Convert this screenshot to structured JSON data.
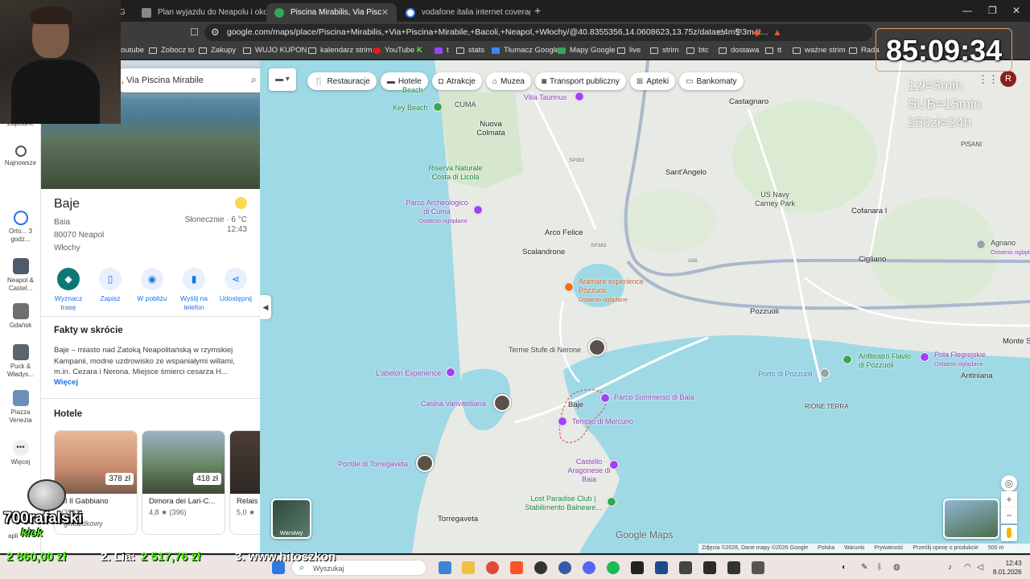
{
  "browser": {
    "tabs": [
      {
        "title": "Plan wyjazdu do Neapolu i okolic - G"
      },
      {
        "title": "Piscina Mirabilis, Via Piscina Mira"
      },
      {
        "title": "vodafone italia internet coverage - S"
      }
    ],
    "tab_prefix": "G",
    "url": "google.com/maps/place/Piscina+Mirabilis,+Via+Piscina+Mirabile,+Bacoli,+Neapol,+Włochy/@40.8355356,14.0608623,13.75z/data=!4m5!3m4!...",
    "bookmarks": [
      "outube",
      "Zobocz to",
      "Zakupy",
      "WUJO KUPON",
      "kalendarz strim",
      "YouTube",
      "K",
      "t",
      "stats",
      "Tłumacz Google",
      "Mapy Google",
      "live",
      "strim",
      "btc",
      "dostawa",
      "tt",
      "ważne strim",
      "Rada"
    ]
  },
  "overlay": {
    "timer": "85:09:34",
    "rules": [
      "1zł=3min",
      "SUB=15min",
      "250zł=24h"
    ],
    "streamer": "700rafalski",
    "platform": "kick",
    "ticker": [
      "2 860,00 zł",
      "2. Lia:",
      "2 517,76 zł",
      "3. www.hitoszkon"
    ]
  },
  "rail": [
    {
      "label": "Zapisane"
    },
    {
      "label": "Najnowsze"
    },
    {
      "label": "Orto... 3 godz..."
    },
    {
      "label": "Neapol & Castel..."
    },
    {
      "label": "Gdańsk"
    },
    {
      "label": "Puck & Władys..."
    },
    {
      "label": "Piazza Venezia"
    },
    {
      "label": "Więcej"
    },
    {
      "label": "apli"
    }
  ],
  "search": {
    "value": ", Via Piscina Mirabile"
  },
  "place": {
    "name": "Baje",
    "line1": "Baia",
    "line2": "80070 Neapol",
    "line3": "Włochy",
    "weather": "Słonecznie · 6 °C",
    "time": "12:43"
  },
  "actions": [
    {
      "label": "Wyznacz trasę"
    },
    {
      "label": "Zapisz"
    },
    {
      "label": "W pobliżu"
    },
    {
      "label": "Wyślij na telefon"
    },
    {
      "label": "Udostępnij"
    }
  ],
  "facts": {
    "heading": "Fakty w skrócie",
    "text": "Baje – miasto nad Zatoką Neapolitańską w rzymskiej Kampanii, modne uzdrowisko ze wspaniałymi willami, m.in. Cezara i Nerona. Miejsce śmierci cesarza H...",
    "more": "Więcej"
  },
  "hotels": {
    "heading": "Hotele",
    "items": [
      {
        "name": "el Il Gabbiano",
        "price": "378 zł",
        "rating": "(3531)",
        "sub": "-gwiazdkowy"
      },
      {
        "name": "Dimora dei Lari-C...",
        "price": "418 zł",
        "rating": "4,8 ★ (396)",
        "sub": ""
      },
      {
        "name": "Relais",
        "price": "",
        "rating": "5,0 ★",
        "sub": ""
      }
    ]
  },
  "chips": [
    {
      "label": "Restauracje",
      "icon": "fork-knife-icon"
    },
    {
      "label": "Hotele",
      "icon": "bed-icon"
    },
    {
      "label": "Atrakcje",
      "icon": "camera-icon"
    },
    {
      "label": "Muzea",
      "icon": "museum-icon"
    },
    {
      "label": "Transport publiczny",
      "icon": "train-icon"
    },
    {
      "label": "Apteki",
      "icon": "pharmacy-icon"
    },
    {
      "label": "Bankomaty",
      "icon": "atm-icon"
    }
  ],
  "map": {
    "labels": {
      "villa": "Villa Taurinus",
      "castagnaro": "Castagnaro",
      "keybeach": "Key Beach",
      "cuma": "CUMA",
      "beach": "Beach",
      "nuova": "Nuova Colmata",
      "riserva": "Riserva Naturale Costa di Licola",
      "santangelo": "Sant'Angelo",
      "usnavy": "US Navy Carney Park",
      "pisani": "PISANI",
      "cofanara": "Cofanara I",
      "parco": "Parco Archeologico di Cuma",
      "parco_sub": "Ostatnio oglądane",
      "arco": "Arco Felice",
      "scalandrone": "Scalandrone",
      "agnano": "Agnano",
      "agnano_sub": "Ostatnio oglądane",
      "cigliano": "Cigliano",
      "aramare": "Aramare experience Pozzuoli",
      "aramare_sub": "Ostatnio oglądane",
      "pozzuoli": "Pozzuoli",
      "terme": "Terme Stufe di Nerone",
      "anfiteatro": "Anfiteatro Flavio di Pozzuoli",
      "pola": "Pola Flegrejskie",
      "pola_sub": "Ostatnio oglądane",
      "monte": "Monte S",
      "labelon": "L'abelon Experience",
      "porto": "Porto di Pozzuoli",
      "antiniana": "Antiniana",
      "sommerso": "Parco Sommerso di Baia",
      "casina": "Casina Vanvitelliana",
      "baje": "Baje",
      "rione": "RIONE TERRA",
      "tempio": "Tempio di Mercurio",
      "castello": "Castello Aragonese di Baia",
      "pontile": "Pontile di Torregaveta",
      "lost": "Lost Paradise Club | Stabilimento Balneare...",
      "torregaveta": "Torregaveta",
      "sp": "SP383",
      "a56": "A56"
    },
    "layers_label": "Warstwy",
    "logo": "Google Maps",
    "footer": [
      "Zdjęcia ©2026, Dane mapy ©2026 Google",
      "Polska",
      "Warunki",
      "Prywatność",
      "Prześlij opinię o produkcie",
      "500 m"
    ]
  },
  "taskbar": {
    "search_placeholder": "Wyszukaj",
    "time": "12:43",
    "date": "8.01.2026"
  },
  "colors": {
    "accent": "#1a73e8",
    "sea": "#9fd9e6",
    "primary_action": "#0b7a76",
    "timer_border": "#e89c5a"
  }
}
